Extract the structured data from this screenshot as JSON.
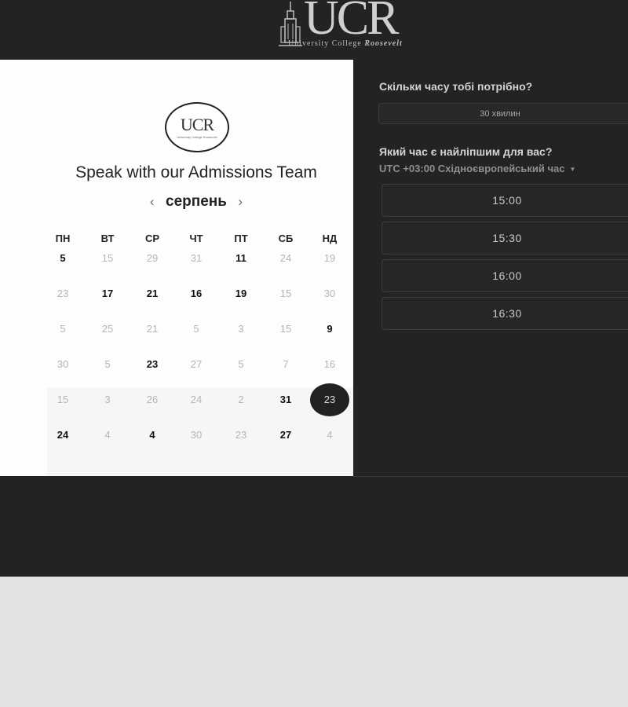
{
  "header": {
    "logo_letters": "UCR",
    "logo_subtitle": "University College",
    "logo_subtitle_script": "Roosevelt"
  },
  "calendar": {
    "badge_letters": "UCR",
    "badge_subtitle": "University College Roosevelt",
    "title": "Speak with our Admissions Team",
    "month": "серпень",
    "prev_arrow": "‹",
    "next_arrow": "›",
    "weekdays": [
      "ПН",
      "ВТ",
      "СР",
      "ЧТ",
      "ПТ",
      "СБ",
      "НД"
    ],
    "weeks": [
      [
        {
          "d": "5",
          "s": "avail"
        },
        {
          "d": "15",
          "s": "dim"
        },
        {
          "d": "29",
          "s": "dim"
        },
        {
          "d": "31",
          "s": "dim"
        },
        {
          "d": "11",
          "s": "avail"
        },
        {
          "d": "24",
          "s": "dim"
        },
        {
          "d": "19",
          "s": "dim"
        }
      ],
      [
        {
          "d": "23",
          "s": "dim"
        },
        {
          "d": "17",
          "s": "avail"
        },
        {
          "d": "21",
          "s": "avail"
        },
        {
          "d": "16",
          "s": "avail"
        },
        {
          "d": "19",
          "s": "avail"
        },
        {
          "d": "15",
          "s": "dim"
        },
        {
          "d": "30",
          "s": "dim"
        }
      ],
      [
        {
          "d": "5",
          "s": "dim"
        },
        {
          "d": "25",
          "s": "dim"
        },
        {
          "d": "21",
          "s": "dim"
        },
        {
          "d": "5",
          "s": "dim"
        },
        {
          "d": "3",
          "s": "dim"
        },
        {
          "d": "15",
          "s": "dim"
        },
        {
          "d": "9",
          "s": "avail"
        }
      ],
      [
        {
          "d": "30",
          "s": "dim"
        },
        {
          "d": "5",
          "s": "dim"
        },
        {
          "d": "23",
          "s": "avail"
        },
        {
          "d": "27",
          "s": "dim"
        },
        {
          "d": "5",
          "s": "dim"
        },
        {
          "d": "7",
          "s": "dim"
        },
        {
          "d": "16",
          "s": "dim"
        }
      ],
      [
        {
          "d": "15",
          "s": "dim"
        },
        {
          "d": "3",
          "s": "dim"
        },
        {
          "d": "26",
          "s": "dim"
        },
        {
          "d": "24",
          "s": "dim"
        },
        {
          "d": "2",
          "s": "dim"
        },
        {
          "d": "31",
          "s": "avail"
        },
        {
          "d": "23",
          "s": "selected"
        }
      ],
      [
        {
          "d": "24",
          "s": "avail"
        },
        {
          "d": "4",
          "s": "dim"
        },
        {
          "d": "4",
          "s": "avail"
        },
        {
          "d": "30",
          "s": "dim"
        },
        {
          "d": "23",
          "s": "dim"
        },
        {
          "d": "27",
          "s": "avail"
        },
        {
          "d": "4",
          "s": "dim"
        }
      ]
    ]
  },
  "booking": {
    "duration_question": "Скільки часу тобі потрібно?",
    "duration_value": "30 хвилин",
    "time_question": "Який час є найліпшим для вас?",
    "timezone": "UTC +03:00 Східноєвропейський час",
    "slots": [
      "15:00",
      "15:30",
      "16:00",
      "16:30"
    ]
  },
  "colors": {
    "dark_background": "#232323",
    "page_background": "#e3e3e3",
    "panel_background": "#fdfdfd",
    "selected_day": "#222222"
  }
}
